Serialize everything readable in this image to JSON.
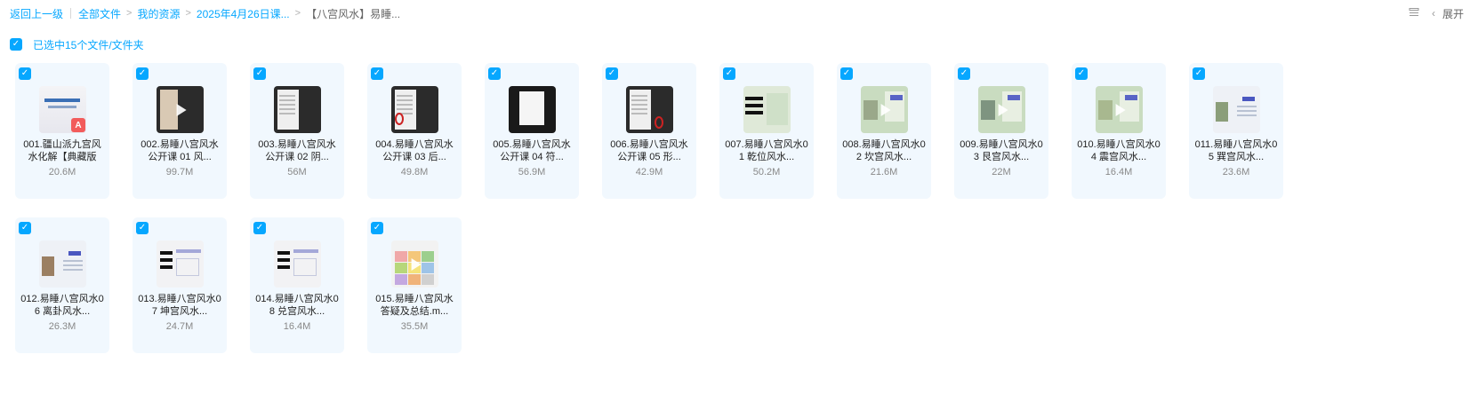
{
  "breadcrumb": {
    "back": "返回上一级",
    "items": [
      "全部文件",
      "我的资源",
      "2025年4月26日课...",
      "【八宫风水】易睡..."
    ]
  },
  "toolbar": {
    "list_icon": "list-view-icon",
    "expand_label": "展开",
    "chevron_icon": "chevron-left-icon"
  },
  "selection": {
    "label": "已选中15个文件/文件夹",
    "checked": true
  },
  "colors": {
    "accent": "#06a7ff",
    "card_bg": "#f1f8fe",
    "pdf_badge": "#f25b5b"
  },
  "files": [
    {
      "name": "001.疆山派九宫风水化解【典藏版",
      "size": "20.6M",
      "kind": "pdf"
    },
    {
      "name": "002.易睡八宫风水公开课 01 风...",
      "size": "99.7M",
      "kind": "video"
    },
    {
      "name": "003.易睡八宫风水公开课 02 阴...",
      "size": "56M",
      "kind": "video"
    },
    {
      "name": "004.易睡八宫风水公开课 03 后...",
      "size": "49.8M",
      "kind": "video"
    },
    {
      "name": "005.易睡八宫风水公开课 04 符...",
      "size": "56.9M",
      "kind": "video"
    },
    {
      "name": "006.易睡八宫风水公开课 05 形...",
      "size": "42.9M",
      "kind": "video"
    },
    {
      "name": "007.易睡八宫风水01 乾位风水...",
      "size": "50.2M",
      "kind": "video"
    },
    {
      "name": "008.易睡八宫风水02 坎宫风水...",
      "size": "21.6M",
      "kind": "video"
    },
    {
      "name": "009.易睡八宫风水03 艮宫风水...",
      "size": "22M",
      "kind": "video"
    },
    {
      "name": "010.易睡八宫风水04 震宫风水...",
      "size": "16.4M",
      "kind": "video"
    },
    {
      "name": "011.易睡八宫风水05 巽宫风水...",
      "size": "23.6M",
      "kind": "video"
    },
    {
      "name": "012.易睡八宫风水06 离卦风水...",
      "size": "26.3M",
      "kind": "video"
    },
    {
      "name": "013.易睡八宫风水07 坤宫风水...",
      "size": "24.7M",
      "kind": "video"
    },
    {
      "name": "014.易睡八宫风水08 兑宫风水...",
      "size": "16.4M",
      "kind": "video"
    },
    {
      "name": "015.易睡八宫风水答疑及总结.m...",
      "size": "35.5M",
      "kind": "video"
    }
  ]
}
